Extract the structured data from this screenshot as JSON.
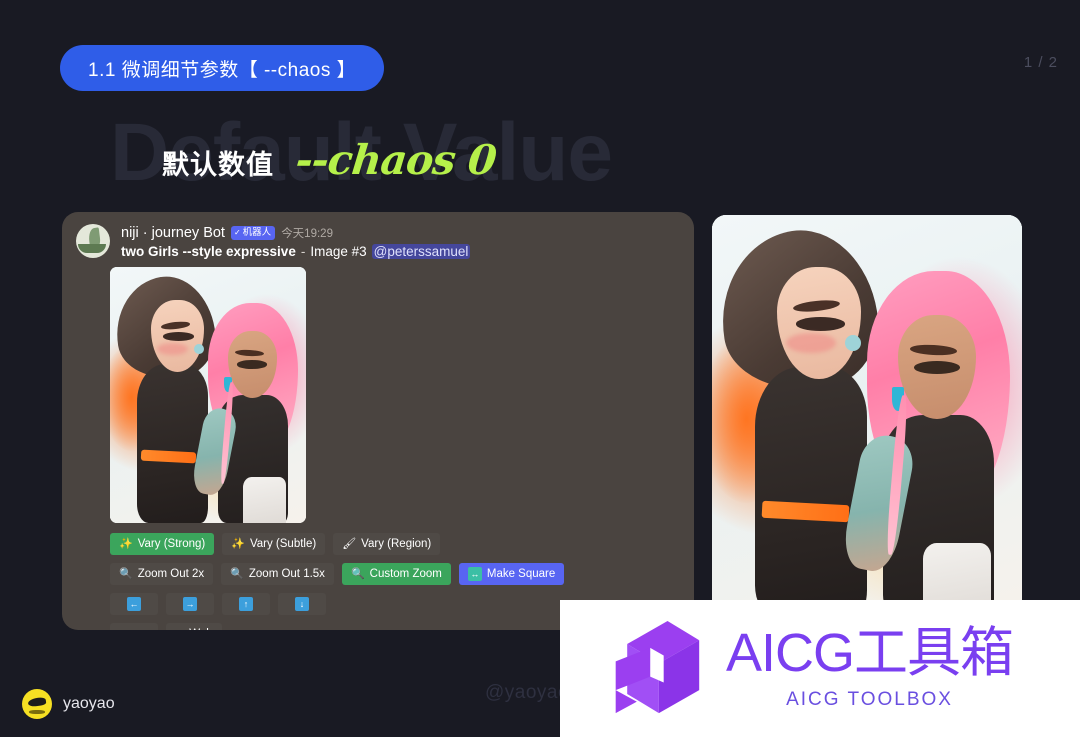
{
  "slide": {
    "title_pill": "1.1 微调细节参数【 --chaos 】",
    "page_indicator": "1 / 2",
    "ghost_heading": "Default Value",
    "heading_cn": "默认数值",
    "heading_param": "--chaos 0",
    "center_watermark": "@yaoyao",
    "colors": {
      "background": "#191a23",
      "pill": "#2f5de8",
      "accent_green": "#b5f04a",
      "ghost_text": "#282a37",
      "discord_panel": "#4a4440",
      "blurple": "#5865f2",
      "discord_green": "#3ba55c",
      "logo_purple": "#7a3ff0"
    }
  },
  "discord": {
    "bot_name": "niji · journey Bot",
    "bot_badge": "机器人",
    "bot_badge_check": "✓",
    "timestamp": "今天19:29",
    "prompt": "two Girls --style expressive",
    "prompt_separator": "-",
    "image_label": "Image #3",
    "mention": "@peterssamuel",
    "button_rows": [
      [
        {
          "label": "Vary (Strong)",
          "style": "green",
          "icon": "sparkle-wand-icon",
          "glyph": "✨"
        },
        {
          "label": "Vary (Subtle)",
          "style": "grey",
          "icon": "sparkle-wand-icon",
          "glyph": "✨"
        },
        {
          "label": "Vary (Region)",
          "style": "grey",
          "icon": "paintbrush-icon",
          "glyph": "🖌"
        }
      ],
      [
        {
          "label": "Zoom Out 2x",
          "style": "grey",
          "icon": "magnifier-icon",
          "glyph": "🔍"
        },
        {
          "label": "Zoom Out 1.5x",
          "style": "grey",
          "icon": "magnifier-icon",
          "glyph": "🔍"
        },
        {
          "label": "Custom Zoom",
          "style": "green",
          "icon": "magnifier-icon",
          "glyph": "🔍"
        },
        {
          "label": "Make Square",
          "style": "blurple",
          "icon": "left-right-arrows-icon",
          "glyph": "↔"
        }
      ],
      [
        {
          "label": "",
          "style": "grey",
          "icon": "arrow-left-icon",
          "glyph": "←"
        },
        {
          "label": "",
          "style": "grey",
          "icon": "arrow-right-icon",
          "glyph": "→"
        },
        {
          "label": "",
          "style": "grey",
          "icon": "arrow-up-icon",
          "glyph": "↑"
        },
        {
          "label": "",
          "style": "grey",
          "icon": "arrow-down-icon",
          "glyph": "↓"
        }
      ],
      [
        {
          "label": "",
          "style": "grey",
          "icon": "heart-icon",
          "glyph": "❤"
        },
        {
          "label": "Web",
          "style": "grey",
          "icon": "external-link-icon",
          "glyph": "↗"
        }
      ]
    ]
  },
  "author": {
    "name": "yaoyao",
    "avatar": "yaoyao-avatar"
  },
  "logo": {
    "title": "AICG工具箱",
    "subtitle": "AICG TOOLBOX",
    "mark": "aicg-cube-logo"
  }
}
